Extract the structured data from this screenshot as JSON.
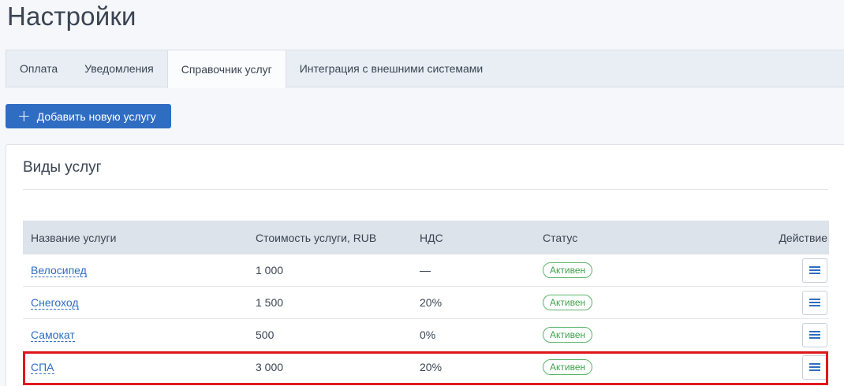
{
  "page": {
    "title": "Настройки"
  },
  "tabs": [
    {
      "label": "Оплата"
    },
    {
      "label": "Уведомления"
    },
    {
      "label": "Справочник услуг",
      "active": true
    },
    {
      "label": "Интеграция с внешними системами"
    }
  ],
  "toolbar": {
    "add_label": "Добавить новую услугу"
  },
  "panel": {
    "title": "Виды услуг"
  },
  "table": {
    "columns": [
      "Название услуги",
      "Стоимость услуги, RUB",
      "НДС",
      "Статус",
      "Действие"
    ],
    "rows": [
      {
        "name": "Велосипед",
        "price": "1 000",
        "vat": "—",
        "status": "Активен"
      },
      {
        "name": "Снегоход",
        "price": "1 500",
        "vat": "20%",
        "status": "Активен"
      },
      {
        "name": "Самокат",
        "price": "500",
        "vat": "0%",
        "status": "Активен"
      },
      {
        "name": "СПА",
        "price": "3 000",
        "vat": "20%",
        "status": "Активен"
      }
    ]
  },
  "colors": {
    "accent": "#2f6dc2",
    "status_active": "#3fa34d",
    "highlight": "#e0181c"
  },
  "icons": {
    "add": "plus-icon",
    "row_action": "hamburger-menu-icon"
  }
}
